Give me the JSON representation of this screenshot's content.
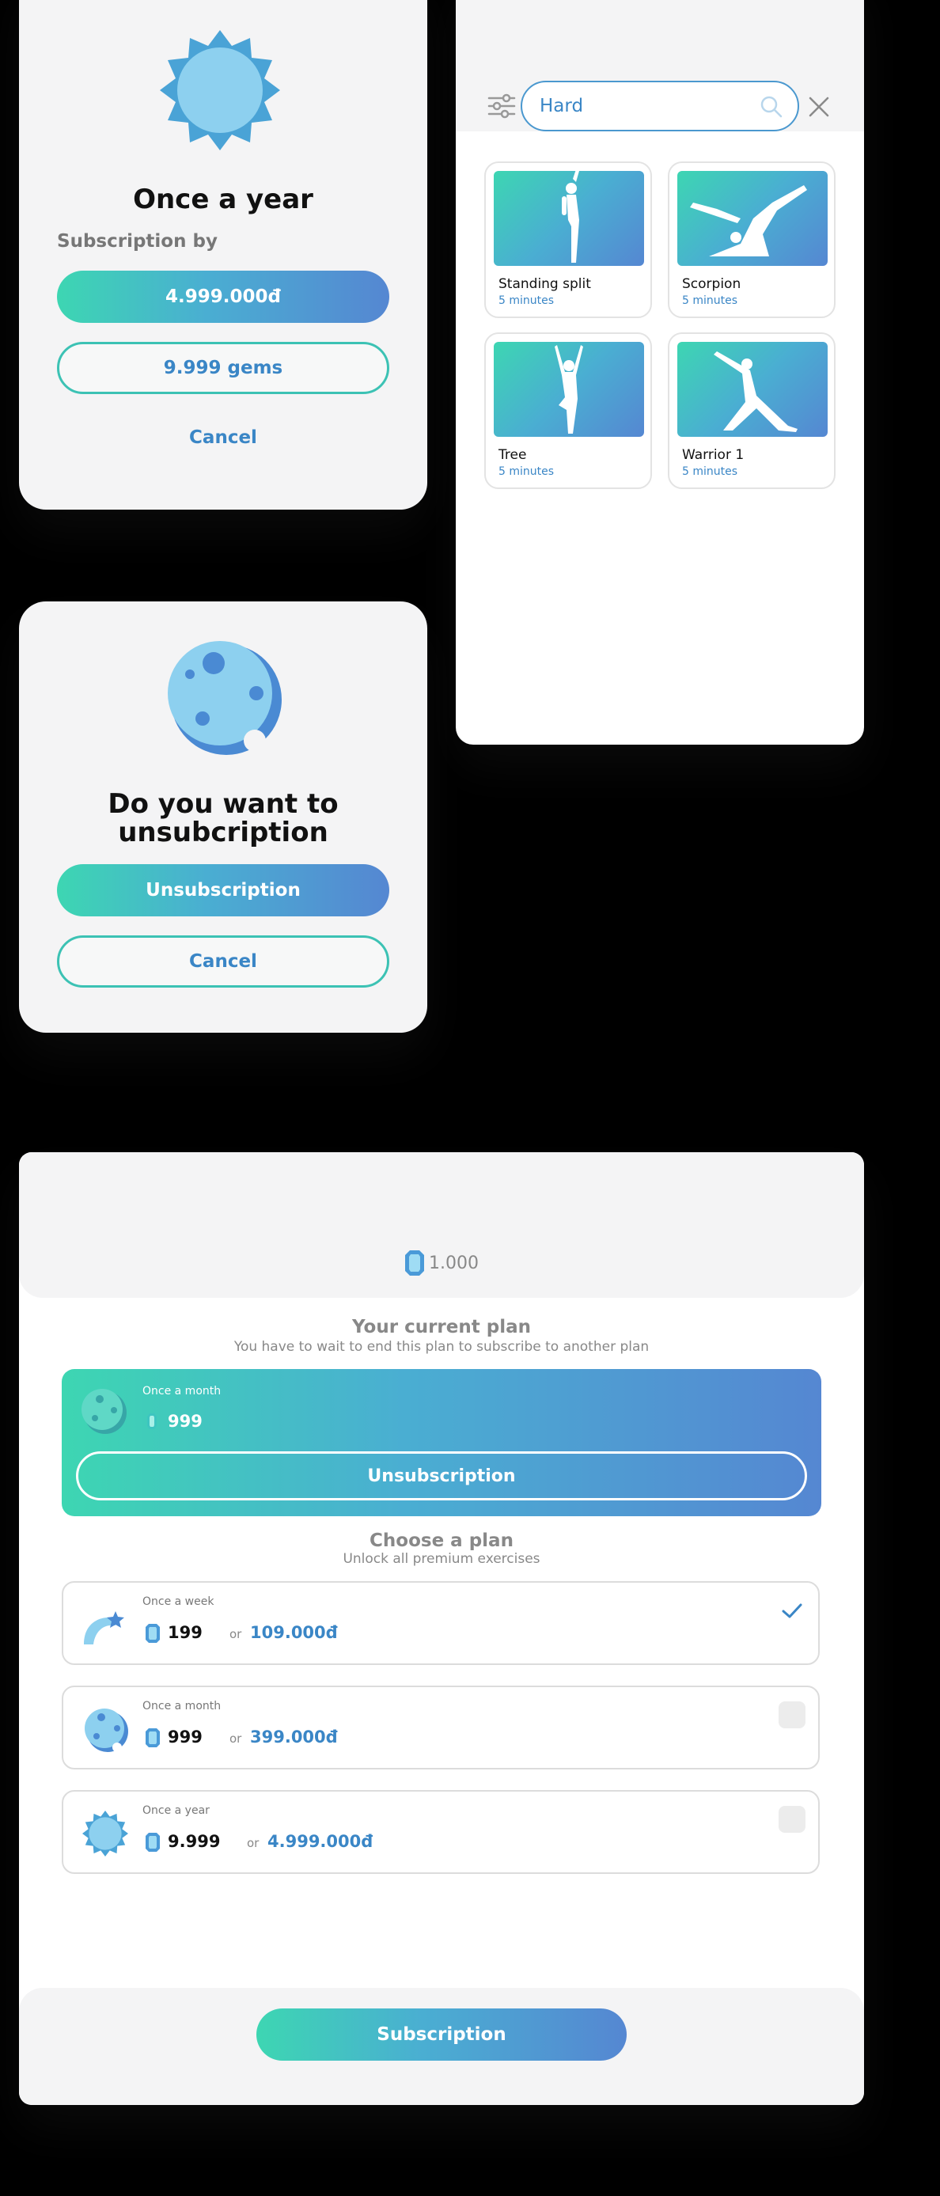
{
  "year_dialog": {
    "title": "Once a year",
    "subtitle": "Subscription by",
    "price_button": "4.999.000đ",
    "gems_button": "9.999 gems",
    "cancel": "Cancel"
  },
  "search_panel": {
    "query": "Hard",
    "poses": [
      {
        "name": "Standing split",
        "duration": "5 minutes"
      },
      {
        "name": "Scorpion",
        "duration": "5 minutes"
      },
      {
        "name": "Tree",
        "duration": "5 minutes"
      },
      {
        "name": "Warrior 1",
        "duration": "5 minutes"
      }
    ]
  },
  "unsub_dialog": {
    "title_line1": "Do you want to",
    "title_line2": "unsubcription",
    "confirm": "Unsubscription",
    "cancel": "Cancel"
  },
  "plans_screen": {
    "gem_balance": "1.000",
    "current_title": "Your current plan",
    "current_subtitle": "You have to wait to end this plan to subscribe to another plan",
    "current_plan": {
      "name": "Once a month",
      "gems": "999",
      "button": "Unsubscription"
    },
    "choose_title": "Choose a plan",
    "choose_subtitle": "Unlock all premium exercises",
    "plans": [
      {
        "name": "Once a week",
        "gems": "199",
        "or": "or",
        "price": "109.000đ",
        "selected": true
      },
      {
        "name": "Once a month",
        "gems": "999",
        "or": "or",
        "price": "399.000đ",
        "selected": false
      },
      {
        "name": "Once a year",
        "gems": "9.999",
        "or": "or",
        "price": "4.999.000đ",
        "selected": false
      }
    ],
    "subscribe_button": "Subscription"
  },
  "colors": {
    "accent": "#3a86c6",
    "gradient_start": "#3dd6b2",
    "gradient_end": "#5587d2",
    "card": "#f4f4f5"
  }
}
